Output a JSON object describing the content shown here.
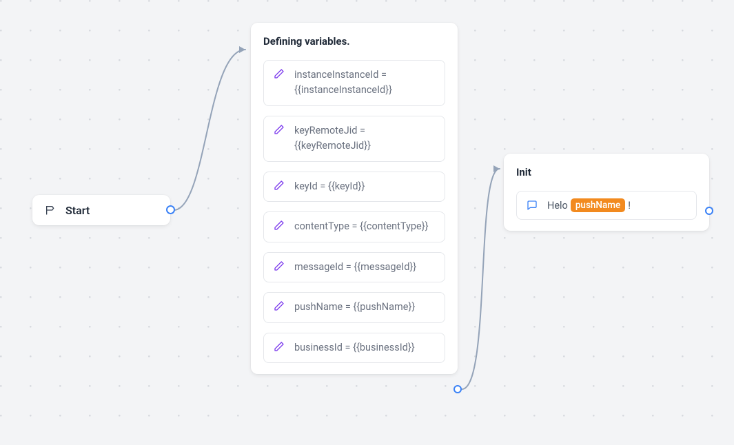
{
  "start": {
    "label": "Start"
  },
  "varsNode": {
    "title": "Defining variables.",
    "items": [
      "instanceInstanceId = {{instanceInstanceId}}",
      "keyRemoteJid = {{keyRemoteJid}}",
      "keyId = {{keyId}}",
      "contentType = {{contentType}}",
      "messageId = {{messageId}}",
      "pushName = {{pushName}}",
      "businessId = {{businessId}}"
    ]
  },
  "initNode": {
    "title": "Init",
    "messagePrefix": "Helo ",
    "tag": "pushName",
    "messageSuffix": "!"
  }
}
